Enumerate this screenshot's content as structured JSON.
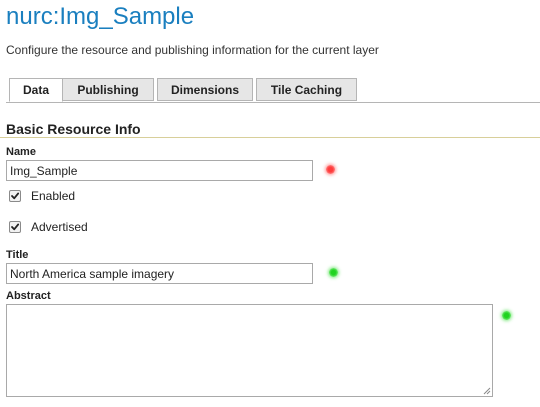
{
  "header": {
    "title": "nurc:Img_Sample",
    "description": "Configure the resource and publishing information for the current layer"
  },
  "tabs": [
    {
      "label": "Data",
      "active": true
    },
    {
      "label": "Publishing",
      "active": false
    },
    {
      "label": "Dimensions",
      "active": false
    },
    {
      "label": "Tile Caching",
      "active": false
    }
  ],
  "section": {
    "title": "Basic Resource Info"
  },
  "form": {
    "name": {
      "label": "Name",
      "value": "Img_Sample",
      "status": "invalid"
    },
    "enabled": {
      "label": "Enabled",
      "checked": true
    },
    "advertised": {
      "label": "Advertised",
      "checked": true
    },
    "title": {
      "label": "Title",
      "value": "North America sample imagery",
      "status": "valid"
    },
    "abstract": {
      "label": "Abstract",
      "value": "",
      "status": "valid"
    }
  },
  "colors": {
    "title_blue": "#1a7fbf",
    "status_invalid": "#ff3b3b",
    "status_valid": "#1fd31f",
    "section_rule": "#d8cf9a"
  },
  "icons": {
    "checkbox": "check-icon",
    "status": "status-dot-icon",
    "resize": "resize-grip-icon"
  }
}
